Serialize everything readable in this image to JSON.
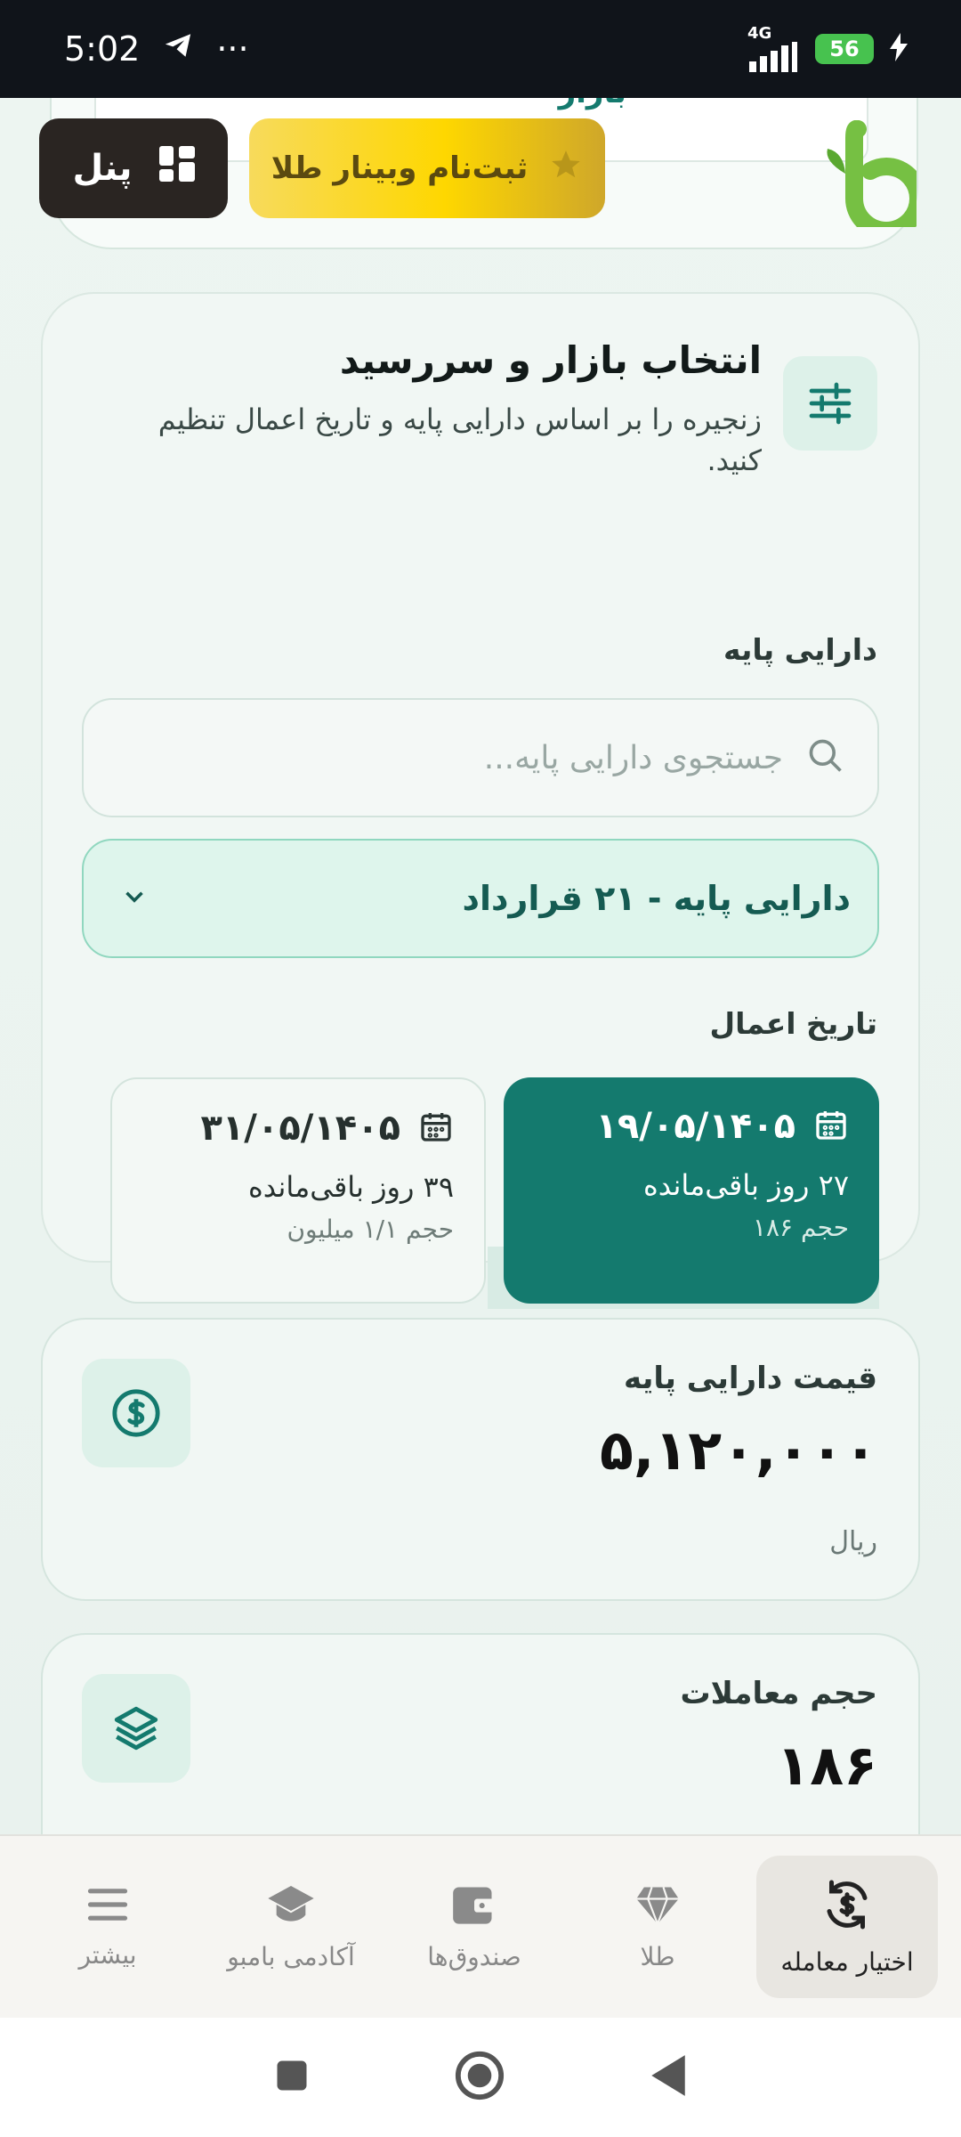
{
  "status_bar": {
    "time": "5:02",
    "more": "···",
    "network": "4G",
    "battery": "56"
  },
  "header": {
    "panel_label": "پنل",
    "webinar_label": "ثبت‌نام وبینار طلا",
    "partial_text": "بازار"
  },
  "market_card": {
    "title": "انتخاب بازار و سررسید",
    "description": "زنجیره را بر اساس دارایی پایه و تاریخ اعمال تنظیم کنید.",
    "asset_label": "دارایی پایه",
    "search_placeholder": "جستجوی دارایی پایه...",
    "selected_asset": "دارایی پایه - ۲۱ قرارداد",
    "exercise_date_label": "تاریخ اعمال",
    "dates": [
      {
        "date": "۱۹/۰۵/۱۴۰۵",
        "days_left": "۲۷ روز باقی‌مانده",
        "volume": "حجم ۱۸۶",
        "selected": true
      },
      {
        "date": "۳۱/۰۵/۱۴۰۵",
        "days_left": "۳۹ روز باقی‌مانده",
        "volume": "حجم ۱/۱ میلیون",
        "selected": false
      }
    ]
  },
  "price_card": {
    "label": "قیمت دارایی پایه",
    "value": "۵,۱۲۰,۰۰۰",
    "unit": "ریال"
  },
  "volume_card": {
    "label": "حجم معاملات",
    "value": "۱۸۶"
  },
  "bottom_nav": [
    {
      "label": "اختیار معامله",
      "icon": "exchange-dollar-icon",
      "active": true
    },
    {
      "label": "طلا",
      "icon": "diamond-icon",
      "active": false
    },
    {
      "label": "صندوق‌ها",
      "icon": "wallet-icon",
      "active": false
    },
    {
      "label": "آکادمی بامبو",
      "icon": "graduation-cap-icon",
      "active": false
    },
    {
      "label": "بیشتر",
      "icon": "menu-icon",
      "active": false
    }
  ],
  "colors": {
    "primary": "#147a6e",
    "accent_gold": "#fed700",
    "dark": "#2a2522"
  }
}
